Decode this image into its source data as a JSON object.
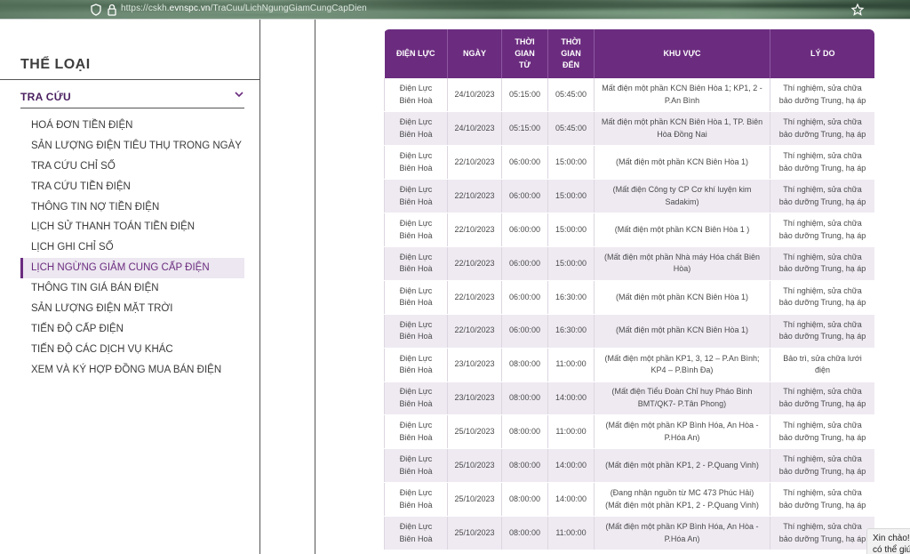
{
  "browser": {
    "url_prefix": "https://cskh.",
    "url_host": "evnspc.vn",
    "url_path": "/TraCuu/LichNgungGiamCungCapDien",
    "icons": [
      "shield-icon",
      "lock-icon",
      "star-icon"
    ]
  },
  "sidebar": {
    "title": "THỂ LOẠI",
    "section": "TRA CỨU",
    "items": [
      "HOÁ ĐƠN TIỀN ĐIỆN",
      "SẢN LƯỢNG ĐIỆN TIÊU THỤ TRONG NGÀY",
      "TRA CỨU CHỈ SỐ",
      "TRA CỨU TIỀN ĐIỆN",
      "THÔNG TIN NỢ TIỀN ĐIỆN",
      "LỊCH SỬ THANH TOÁN TIỀN ĐIỆN",
      "LỊCH GHI CHỈ SỐ",
      "LỊCH NGỪNG GIẢM CUNG CẤP ĐIỆN",
      "THÔNG TIN GIÁ BÁN ĐIỆN",
      "SẢN LƯỢNG ĐIỆN MẶT TRỜI",
      "TIẾN ĐỘ CẤP ĐIỆN",
      "TIẾN ĐỘ CÁC DỊCH VỤ KHÁC",
      "XEM VÀ KÝ HỢP ĐỒNG MUA BÁN ĐIỆN"
    ],
    "active_index": 7,
    "accent_color": "#6b2c7f"
  },
  "table": {
    "header_color": "#6b2c7f",
    "columns": [
      "ĐIỆN LỰC",
      "NGÀY",
      "THỜI\nGIAN\nTỪ",
      "THỜI\nGIAN\nĐẾN",
      "KHU VỰC",
      "LÝ DO"
    ],
    "rows": [
      [
        "Điện Lực\nBiên Hoà",
        "24/10/2023",
        "05:15:00",
        "05:45:00",
        "Mất điện một phần KCN Biên Hòa 1; KP1, 2 -\nP.An Bình",
        "Thí nghiệm, sửa chữa\nbảo dưỡng Trung, hạ áp"
      ],
      [
        "Điện Lực\nBiên Hoà",
        "24/10/2023",
        "05:15:00",
        "05:45:00",
        "Mất điện một phần KCN Biên Hòa 1, TP. Biên\nHòa Đồng Nai",
        "Thí nghiệm, sửa chữa\nbảo dưỡng Trung, hạ áp"
      ],
      [
        "Điện Lực\nBiên Hoà",
        "22/10/2023",
        "06:00:00",
        "15:00:00",
        "(Mất điện một phần KCN Biên Hòa 1)",
        "Thí nghiệm, sửa chữa\nbảo dưỡng Trung, hạ áp"
      ],
      [
        "Điện Lực\nBiên Hoà",
        "22/10/2023",
        "06:00:00",
        "15:00:00",
        "(Mất điện Công ty CP Cơ khí luyện kim\nSadakim)",
        "Thí nghiệm, sửa chữa\nbảo dưỡng Trung, hạ áp"
      ],
      [
        "Điện Lực\nBiên Hoà",
        "22/10/2023",
        "06:00:00",
        "15:00:00",
        "(Mất điện một phần KCN Biên Hòa 1 )",
        "Thí nghiệm, sửa chữa\nbảo dưỡng Trung, hạ áp"
      ],
      [
        "Điện Lực\nBiên Hoà",
        "22/10/2023",
        "06:00:00",
        "15:00:00",
        "(Mất điện một phần Nhà máy Hóa chất Biên\nHòa)",
        "Thí nghiệm, sửa chữa\nbảo dưỡng Trung, hạ áp"
      ],
      [
        "Điện Lực\nBiên Hoà",
        "22/10/2023",
        "06:00:00",
        "16:30:00",
        "(Mất điện một phần KCN Biên Hòa 1)",
        "Thí nghiệm, sửa chữa\nbảo dưỡng Trung, hạ áp"
      ],
      [
        "Điện Lực\nBiên Hoà",
        "22/10/2023",
        "06:00:00",
        "16:30:00",
        "(Mất điện một phần KCN Biên Hòa 1)",
        "Thí nghiệm, sửa chữa\nbảo dưỡng Trung, hạ áp"
      ],
      [
        "Điện Lực\nBiên Hoà",
        "23/10/2023",
        "08:00:00",
        "11:00:00",
        "(Mất điện một phần KP1, 3, 12 – P.An Bình;\nKP4 – P.Bình Đa)",
        "Bảo trì, sửa chữa lưới\nđiện"
      ],
      [
        "Điện Lực\nBiên Hoà",
        "23/10/2023",
        "08:00:00",
        "14:00:00",
        "(Mất điện Tiểu Đoàn Chỉ huy Pháo Binh\nBMT/QK7- P.Tân Phong)",
        "Thí nghiệm, sửa chữa\nbảo dưỡng Trung, hạ áp"
      ],
      [
        "Điện Lực\nBiên Hoà",
        "25/10/2023",
        "08:00:00",
        "11:00:00",
        "(Mất điện một phần KP Bình Hóa, An Hòa -\nP.Hóa An)",
        "Thí nghiệm, sửa chữa\nbảo dưỡng Trung, hạ áp"
      ],
      [
        "Điện Lực\nBiên Hoà",
        "25/10/2023",
        "08:00:00",
        "14:00:00",
        "(Mất điện một phần KP1, 2 - P.Quang Vinh)",
        "Thí nghiệm, sửa chữa\nbảo dưỡng Trung, hạ áp"
      ],
      [
        "Điện Lực\nBiên Hoà",
        "25/10/2023",
        "08:00:00",
        "14:00:00",
        "(Đang nhận nguồn từ MC 473 Phúc Hải)\n(Mất điện một phần KP1, 2 - P.Quang Vinh)",
        "Thí nghiệm, sửa chữa\nbảo dưỡng Trung, hạ áp"
      ],
      [
        "Điện Lực\nBiên Hoà",
        "25/10/2023",
        "08:00:00",
        "11:00:00",
        "(Mất điện một phần KP Bình Hóa, An Hòa -\nP.Hóa An)",
        "Thí nghiệm, sửa chữa\nbảo dưỡng Trung, hạ áp"
      ]
    ]
  },
  "chat": {
    "line1": "Xin chào!",
    "line2": "có thể giú"
  }
}
